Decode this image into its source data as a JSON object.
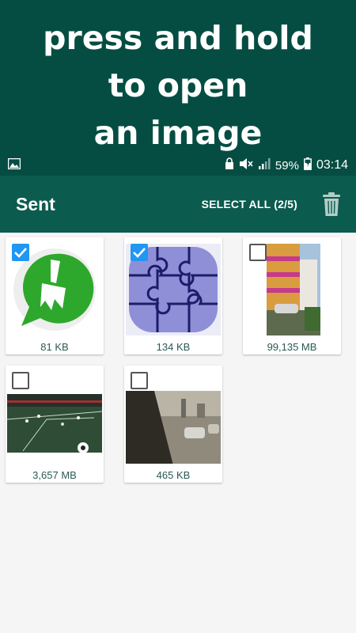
{
  "promo": {
    "line1": "press and hold",
    "line2": "to open",
    "line3": "an image"
  },
  "status_bar": {
    "battery": "59%",
    "time": "03:14",
    "icons": [
      "image-notification-icon",
      "lock-icon",
      "mute-icon",
      "signal-icon",
      "battery-icon"
    ]
  },
  "app_bar": {
    "title": "Sent",
    "select_all": "SELECT ALL (2/5)",
    "delete_icon": "trash-icon"
  },
  "items": [
    {
      "size": "81 KB",
      "checked": true,
      "kind": "cleaner-logo"
    },
    {
      "size": "134 KB",
      "checked": true,
      "kind": "puzzle"
    },
    {
      "size": "99,135 MB",
      "checked": false,
      "kind": "building-photo"
    },
    {
      "size": "3,657 MB",
      "checked": false,
      "kind": "football-video"
    },
    {
      "size": "465 KB",
      "checked": false,
      "kind": "traffic-photo"
    }
  ],
  "colors": {
    "header": "#054d42",
    "app_bar": "#0c5b4f",
    "checkbox": "#2196f3"
  }
}
